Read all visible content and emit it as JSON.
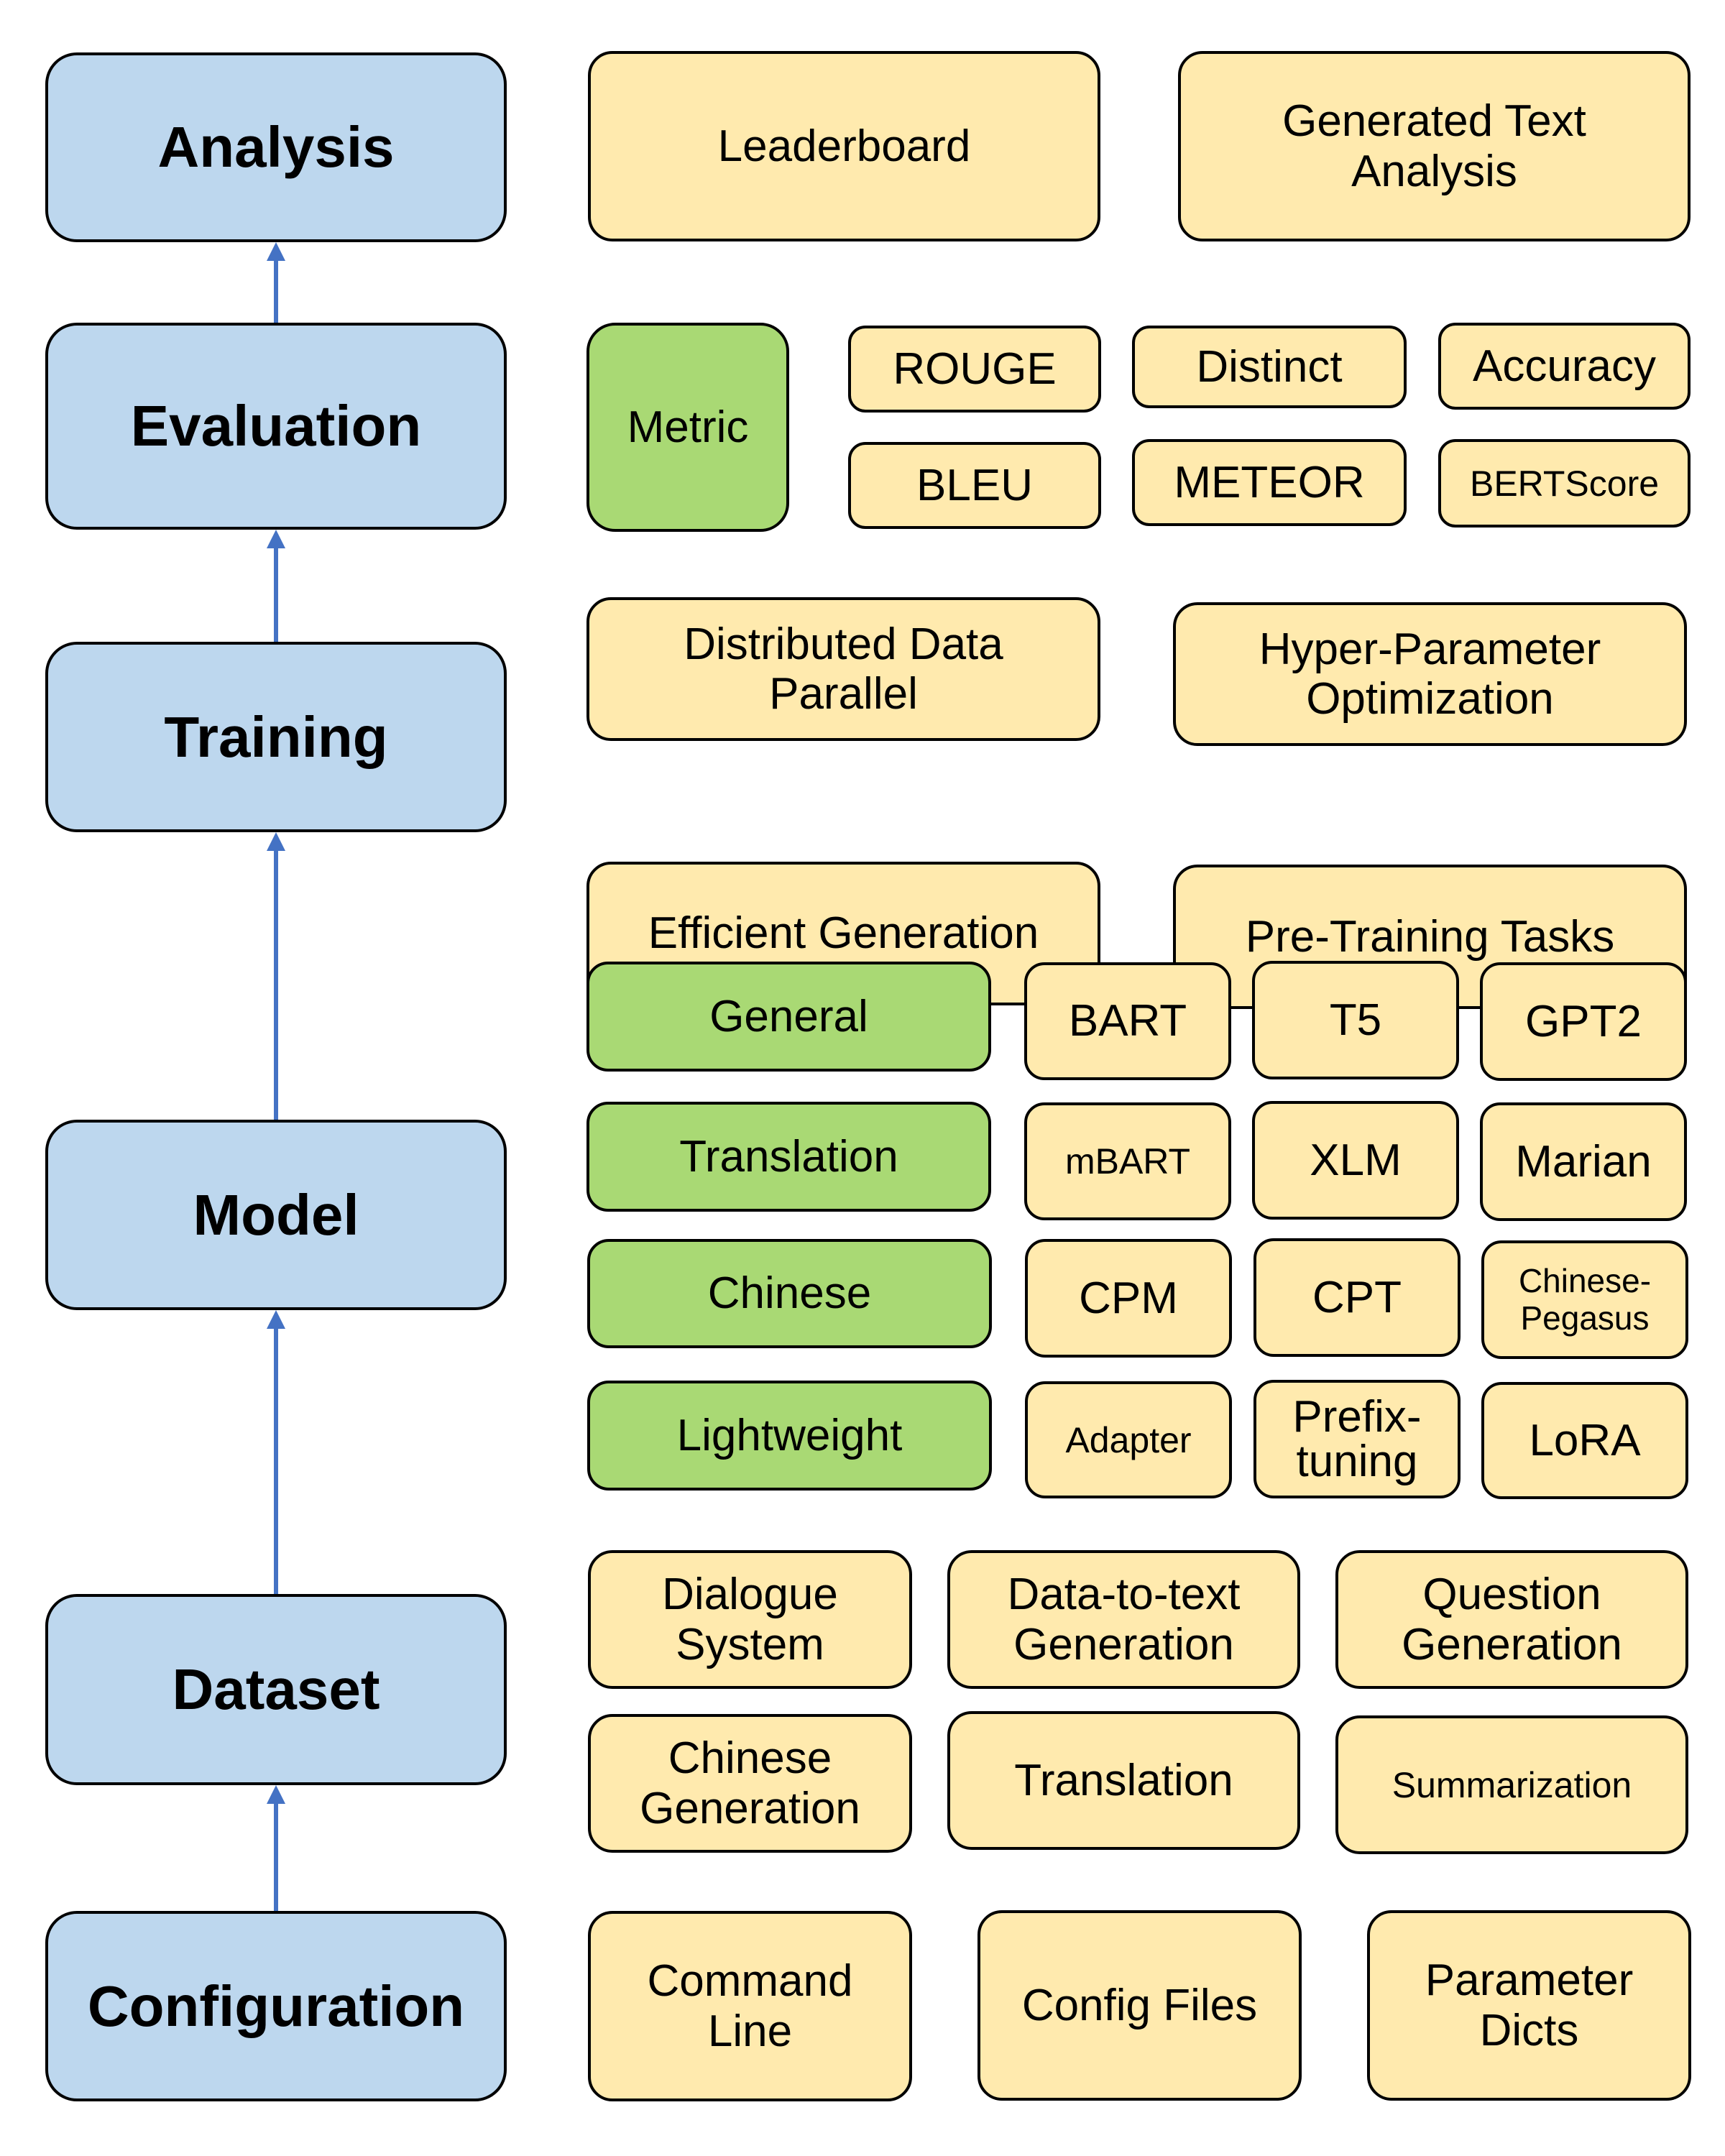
{
  "stages": {
    "analysis": "Analysis",
    "evaluation": "Evaluation",
    "training": "Training",
    "model": "Model",
    "dataset": "Dataset",
    "configuration": "Configuration"
  },
  "analysis": {
    "items": [
      "Leaderboard",
      "Generated Text\nAnalysis"
    ]
  },
  "evaluation": {
    "category": "Metric",
    "metrics": [
      "ROUGE",
      "Distinct",
      "Accuracy",
      "BLEU",
      "METEOR",
      "BERTScore"
    ]
  },
  "training": {
    "items": [
      "Distributed Data\nParallel",
      "Hyper-Parameter\nOptimization",
      "Efficient Generation",
      "Pre-Training Tasks"
    ]
  },
  "model": {
    "rows": [
      {
        "category": "General",
        "models": [
          "BART",
          "T5",
          "GPT2"
        ]
      },
      {
        "category": "Translation",
        "models": [
          "mBART",
          "XLM",
          "Marian"
        ]
      },
      {
        "category": "Chinese",
        "models": [
          "CPM",
          "CPT",
          "Chinese-\nPegasus"
        ]
      },
      {
        "category": "Lightweight",
        "models": [
          "Adapter",
          "Prefix-\ntuning",
          "LoRA"
        ]
      }
    ]
  },
  "dataset": {
    "items": [
      "Dialogue\nSystem",
      "Data-to-text\nGeneration",
      "Question\nGeneration",
      "Chinese\nGeneration",
      "Translation",
      "Summarization"
    ]
  },
  "configuration": {
    "items": [
      "Command\nLine",
      "Config Files",
      "Parameter\nDicts"
    ]
  },
  "colors": {
    "stage": "#bdd7ee",
    "item": "#ffeaae",
    "category": "#a9d974",
    "arrow": "#4472c4"
  }
}
